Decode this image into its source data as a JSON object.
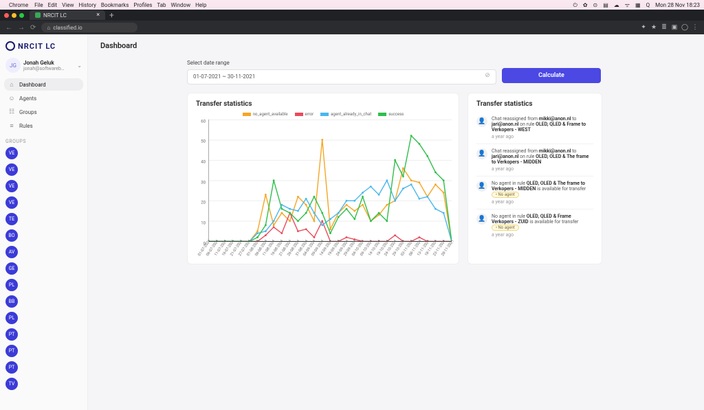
{
  "macbar": {
    "app": "Chrome",
    "menus": [
      "File",
      "Edit",
      "View",
      "History",
      "Bookmarks",
      "Profiles",
      "Tab",
      "Window",
      "Help"
    ],
    "clock": "Mon 28 Nov  18:23"
  },
  "browser": {
    "tab_title": "NRCIT LC",
    "url": "classified.io"
  },
  "brand": {
    "name": "NRCIT LC"
  },
  "user": {
    "initials": "JG",
    "name": "Jonah Geluk",
    "email": "jonah@softwareb…"
  },
  "nav": {
    "items": [
      {
        "label": "Dashboard",
        "icon": "⌂",
        "active": true
      },
      {
        "label": "Agents",
        "icon": "☺",
        "active": false
      },
      {
        "label": "Groups",
        "icon": "☷",
        "active": false
      },
      {
        "label": "Rules",
        "icon": "≡",
        "active": false
      }
    ],
    "groups_label": "GROUPS",
    "groups": [
      "VE",
      "VE",
      "VE",
      "VE",
      "TE",
      "BO",
      "AV",
      "GE",
      "PL",
      "BB",
      "PL",
      "PT",
      "PT",
      "PT",
      "TV"
    ]
  },
  "page_title": "Dashboard",
  "controls": {
    "label": "Select date range",
    "value": "01-07-2021 ~ 30-11-2021",
    "calculate_label": "Calculate"
  },
  "chart_card_title": "Transfer statistics",
  "chart_data": {
    "type": "line",
    "title": "Transfer statistics",
    "xlabel": "",
    "ylabel": "",
    "ylim": [
      0,
      60
    ],
    "yticks": [
      0,
      10,
      20,
      30,
      40,
      50,
      60
    ],
    "categories": [
      "01-07-2021",
      "06-07-2021",
      "11-07-2021",
      "16-07-2021",
      "21-07-2021",
      "27-07-2021",
      "01-08-2021",
      "06-08-2021",
      "11-08-2021",
      "16-08-2021",
      "21-08-2021",
      "26-08-2021",
      "31-08-2021",
      "04-09-2021",
      "09-09-2021",
      "14-09-2021",
      "19-09-2021",
      "24-09-2021",
      "29-09-2021",
      "04-10-2021",
      "09-10-2021",
      "14-10-2021",
      "19-10-2021",
      "24-10-2021",
      "29-10-2021",
      "03-11-2021",
      "08-11-2021",
      "13-11-2021",
      "18-11-2021",
      "23-11-2021",
      "28-11-2021"
    ],
    "legend": [
      "no_agent_available",
      "error",
      "agent_already_in_chat",
      "success"
    ],
    "colors": {
      "no_agent_available": "#f5a623",
      "error": "#e94b5b",
      "agent_already_in_chat": "#49b7ef",
      "success": "#2fbf4a"
    },
    "series": [
      {
        "name": "no_agent_available",
        "values": [
          0,
          0,
          0,
          0,
          0,
          0,
          5,
          23,
          8,
          14,
          10,
          22,
          18,
          10,
          50,
          6,
          14,
          18,
          15,
          18,
          10,
          13,
          18,
          20,
          36,
          30,
          29,
          22,
          28,
          24,
          0
        ]
      },
      {
        "name": "error",
        "values": [
          0,
          0,
          0,
          0,
          0,
          0,
          0,
          3,
          7,
          4,
          14,
          5,
          6,
          2,
          10,
          0,
          0,
          2,
          1,
          0,
          0,
          0,
          0,
          3,
          0,
          0,
          2,
          0,
          0,
          0,
          0
        ]
      },
      {
        "name": "agent_already_in_chat",
        "values": [
          0,
          0,
          0,
          0,
          0,
          0,
          4,
          5,
          10,
          18,
          16,
          15,
          21,
          14,
          8,
          11,
          14,
          20,
          20,
          24,
          27,
          23,
          30,
          20,
          26,
          28,
          21,
          22,
          16,
          14,
          0
        ]
      },
      {
        "name": "success",
        "values": [
          0,
          0,
          0,
          0,
          0,
          0,
          2,
          8,
          30,
          16,
          14,
          10,
          14,
          22,
          14,
          4,
          12,
          16,
          11,
          22,
          10,
          14,
          10,
          40,
          32,
          52,
          48,
          42,
          34,
          30,
          0
        ]
      }
    ]
  },
  "log_card_title": "Transfer statistics",
  "log": [
    {
      "text_pre": "Chat reassigned from ",
      "b1": "mikki@anon.nl",
      "mid": " to ",
      "b2": "jari@anon.nl",
      "mid2": " on rule ",
      "b3": "OLED, QLED & Frame to Verkopers - WEST",
      "time": "a year ago",
      "badge": ""
    },
    {
      "text_pre": "Chat reassigned from ",
      "b1": "mikki@anon.nl",
      "mid": " to ",
      "b2": "jari@anon.nl",
      "mid2": " on rule ",
      "b3": "OLED, OLED & The frame to Verkopers - MIDDEN",
      "time": "a year ago",
      "badge": ""
    },
    {
      "text_pre": "No agent in rule ",
      "b1": "QLED, OLED & The frame to Verkopers - MIDDEN",
      "mid": " is available for transfer ",
      "b2": "",
      "mid2": "",
      "b3": "",
      "time": "a year ago",
      "badge": "• No agent"
    },
    {
      "text_pre": "No agent in rule ",
      "b1": "OLED, QLED & Frame Verkopers - ZUID",
      "mid": " is available for transfer ",
      "b2": "",
      "mid2": "",
      "b3": "",
      "time": "a year ago",
      "badge": "• No agent"
    }
  ]
}
